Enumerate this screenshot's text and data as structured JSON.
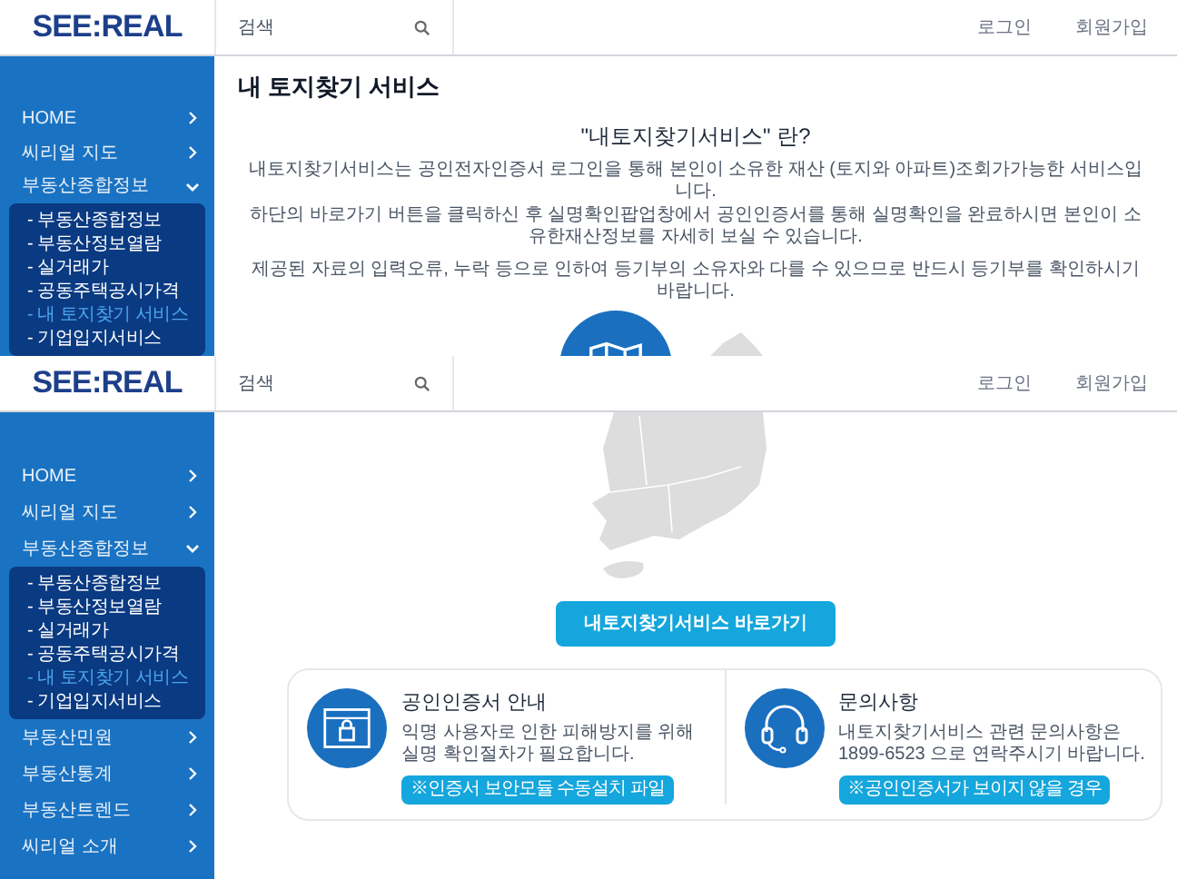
{
  "views": [
    {
      "header": {
        "logo": "SEE:REAL",
        "search_placeholder": "검색",
        "links": [
          "로그인",
          "회원가입"
        ]
      },
      "sidebar": {
        "items": [
          {
            "label": "HOME",
            "expanded": false
          },
          {
            "label": "씨리얼 지도",
            "expanded": false
          },
          {
            "label": "부동산종합정보",
            "expanded": true,
            "children": [
              {
                "label": "- 부동산종합정보",
                "selected": false
              },
              {
                "label": "- 부동산정보열람",
                "selected": false
              },
              {
                "label": "- 실거래가",
                "selected": false
              },
              {
                "label": "- 공동주택공시가격",
                "selected": false
              },
              {
                "label": "- 내 토지찾기 서비스",
                "selected": true
              },
              {
                "label": "- 기업입지서비스",
                "selected": false
              }
            ]
          }
        ]
      },
      "content": {
        "title": "내 토지찾기 서비스",
        "intro_heading": "\"내토지찾기서비스\" 란?",
        "paragraphs": [
          "내토지찾기서비스는 공인전자인증서 로그인을 통해 본인이 소유한 재산 (토지와 아파트)조회가가능한 서비스입니다.",
          "하단의 바로가기 버튼을 클릭하신 후 실명확인팝업창에서 공인인증서를 통해 실명확인을 완료하시면 본인이 소유한재산정보를 자세히 보실 수 있습니다.",
          "제공된 자료의 입력오류, 누락 등으로 인하여 등기부의 소유자와 다를 수 있으므로 반드시 등기부를 확인하시기 바랍니다."
        ]
      }
    },
    {
      "header": {
        "logo": "SEE:REAL",
        "search_placeholder": "검색",
        "links": [
          "로그인",
          "회원가입"
        ]
      },
      "sidebar": {
        "items": [
          {
            "label": "HOME",
            "expanded": false
          },
          {
            "label": "씨리얼 지도",
            "expanded": false
          },
          {
            "label": "부동산종합정보",
            "expanded": true,
            "children": [
              {
                "label": "- 부동산종합정보",
                "selected": false
              },
              {
                "label": "- 부동산정보열람",
                "selected": false
              },
              {
                "label": "- 실거래가",
                "selected": false
              },
              {
                "label": "- 공동주택공시가격",
                "selected": false
              },
              {
                "label": "- 내 토지찾기 서비스",
                "selected": true
              },
              {
                "label": "- 기업입지서비스",
                "selected": false
              }
            ]
          },
          {
            "label": "부동산민원",
            "expanded": false
          },
          {
            "label": "부동산통계",
            "expanded": false
          },
          {
            "label": "부동산트렌드",
            "expanded": false
          },
          {
            "label": "씨리얼 소개",
            "expanded": false
          }
        ]
      },
      "content": {
        "go_button": "내토지찾기서비스 바로가기",
        "cards": [
          {
            "kind": "certificate",
            "title": "공인인증서 안내",
            "text": "익명 사용자로 인한 피해방지를 위해 실명 확인절차가 필요합니다.",
            "button": "※인증서 보안모듈 수동설치 파일"
          },
          {
            "kind": "support",
            "title": "문의사항",
            "text": "내토지찾기서비스 관련 문의사항은 1899-6523 으로 연락주시기 바랍니다.",
            "button": "※공인인증서가 보이지 않을 경우"
          }
        ]
      }
    }
  ]
}
